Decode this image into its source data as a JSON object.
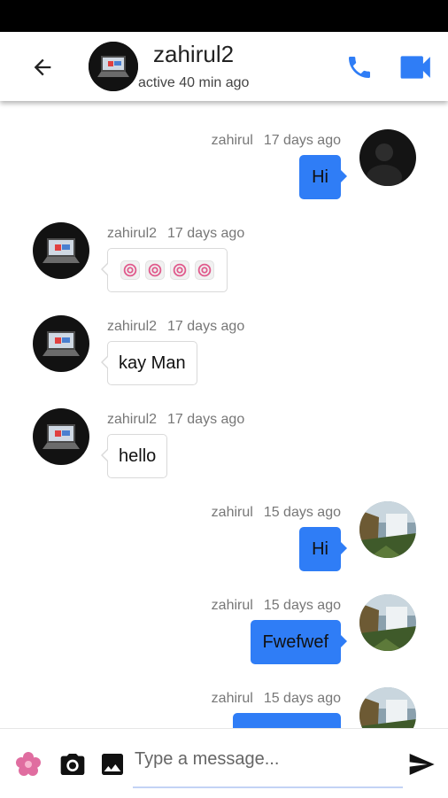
{
  "colors": {
    "accent": "#2f7df6",
    "outgoing_bubble": "#2f7df6"
  },
  "header": {
    "title": "zahirul2",
    "subtitle": "active 40 min ago",
    "back_icon": "arrow-back-icon",
    "call_icon": "phone-icon",
    "video_icon": "video-camera-icon"
  },
  "messages": [
    {
      "sender": "zahirul",
      "time": "17 days ago",
      "text": "Hi",
      "direction": "out"
    },
    {
      "sender": "zahirul2",
      "time": "17 days ago",
      "text": "",
      "direction": "in",
      "stickers": 4
    },
    {
      "sender": "zahirul2",
      "time": "17 days ago",
      "text": "kay Man",
      "direction": "in"
    },
    {
      "sender": "zahirul2",
      "time": "17 days ago",
      "text": "hello",
      "direction": "in"
    },
    {
      "sender": "zahirul",
      "time": "15 days ago",
      "text": "Hi",
      "direction": "out"
    },
    {
      "sender": "zahirul",
      "time": "15 days ago",
      "text": "Fwefwef",
      "direction": "out"
    },
    {
      "sender": "zahirul",
      "time": "15 days ago",
      "text": "",
      "direction": "out"
    }
  ],
  "input": {
    "placeholder": "Type a message...",
    "value": "",
    "sticker_icon": "flower-sticker-icon",
    "camera_icon": "camera-icon",
    "gallery_icon": "image-icon",
    "send_icon": "send-icon"
  }
}
